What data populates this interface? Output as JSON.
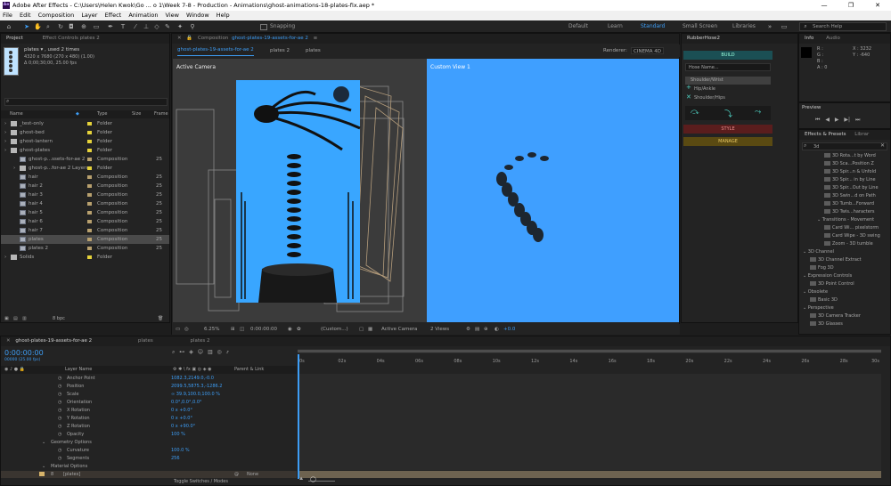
{
  "titlebar": {
    "title": "Adobe After Effects - C:\\Users\\Helen Kwok\\Go ... o 1\\Week 7-8 - Production - Animations\\ghost-animations-18-plates-fix.aep *",
    "logo": "Ae",
    "minimize": "—",
    "maximize": "❐",
    "close": "✕"
  },
  "menu": [
    "File",
    "Edit",
    "Composition",
    "Layer",
    "Effect",
    "Animation",
    "View",
    "Window",
    "Help"
  ],
  "toolbar": {
    "snapping_label": "Snapping",
    "workspaces": [
      "Default",
      "Learn",
      "Standard",
      "Small Screen",
      "Libraries"
    ],
    "active_workspace": "Standard",
    "search_placeholder": "Search Help"
  },
  "project": {
    "tabs": [
      "Project",
      "Effect Controls plates 2"
    ],
    "selected_name": "plates ▾ , used 2 times",
    "selected_dims": "4320 x 7680 (270 x 480) (1.00)",
    "selected_duration": "Δ 0;00;30;00, 25.00 fps",
    "search_placeholder": "",
    "columns": [
      "Name",
      "Type",
      "Size",
      "Frame"
    ],
    "rows": [
      {
        "name": "_test-only",
        "type": "Folder",
        "size": "",
        "indent": 0,
        "kind": "folder"
      },
      {
        "name": "ghost-bed",
        "type": "Folder",
        "size": "",
        "indent": 0,
        "kind": "folder"
      },
      {
        "name": "ghost-lantern",
        "type": "Folder",
        "size": "",
        "indent": 0,
        "kind": "folder"
      },
      {
        "name": "ghost-plates",
        "type": "Folder",
        "size": "",
        "indent": 0,
        "kind": "folder"
      },
      {
        "name": "ghost-p...ssets-for-ae 2",
        "type": "Composition",
        "size": "25",
        "indent": 1,
        "kind": "comp"
      },
      {
        "name": "ghost-p...for-ae 2 Layers",
        "type": "Folder",
        "size": "",
        "indent": 1,
        "kind": "folder"
      },
      {
        "name": "hair",
        "type": "Composition",
        "size": "25",
        "indent": 1,
        "kind": "comp"
      },
      {
        "name": "hair 2",
        "type": "Composition",
        "size": "25",
        "indent": 1,
        "kind": "comp"
      },
      {
        "name": "hair 3",
        "type": "Composition",
        "size": "25",
        "indent": 1,
        "kind": "comp"
      },
      {
        "name": "hair 4",
        "type": "Composition",
        "size": "25",
        "indent": 1,
        "kind": "comp"
      },
      {
        "name": "hair 5",
        "type": "Composition",
        "size": "25",
        "indent": 1,
        "kind": "comp"
      },
      {
        "name": "hair 6",
        "type": "Composition",
        "size": "25",
        "indent": 1,
        "kind": "comp"
      },
      {
        "name": "hair 7",
        "type": "Composition",
        "size": "25",
        "indent": 1,
        "kind": "comp"
      },
      {
        "name": "plates",
        "type": "Composition",
        "size": "25",
        "indent": 1,
        "kind": "comp",
        "selected": true
      },
      {
        "name": "plates 2",
        "type": "Composition",
        "size": "25",
        "indent": 1,
        "kind": "comp"
      },
      {
        "name": "Solids",
        "type": "Folder",
        "size": "",
        "indent": 0,
        "kind": "folder"
      }
    ],
    "footer_bpc": "8 bpc"
  },
  "viewer": {
    "tab_prefix": "Composition",
    "tab_name": "ghost-plates-19-assets-for-ae 2",
    "subtabs": [
      "ghost-plates-19-assets-for-ae 2",
      "plates 2",
      "plates"
    ],
    "renderer_label": "Renderer:",
    "renderer": "CINEMA 4D",
    "left_label": "Active Camera",
    "right_label": "Custom View 1",
    "zoom": "6.25%",
    "timecode": "0:00:00:00",
    "resolution": "(Custom...)",
    "camera": "Active Camera",
    "views": "2 Views",
    "exposure": "+0.0"
  },
  "rubberhose": {
    "title": "RubberHose2",
    "build": "BUILD",
    "hose_name_placeholder": "Hose Name...",
    "items": [
      "Shoulder/Wrist",
      "Hip/Ankle",
      "Shoulder/Hips"
    ],
    "style": "STYLE",
    "manage": "MANAGE"
  },
  "info": {
    "tabs": [
      "Info",
      "Audio"
    ],
    "r": "R :",
    "g": "G :",
    "b": "B :",
    "a": "A : 0",
    "x": "X : 3232",
    "y": "Y : -640"
  },
  "preview": {
    "title": "Preview"
  },
  "effects": {
    "tabs": [
      "Effects & Presets",
      "Librar"
    ],
    "search": "3d",
    "items": [
      {
        "label": "3D Rota...t by Word",
        "indent": 3
      },
      {
        "label": "3D Sca...Position Z",
        "indent": 3
      },
      {
        "label": "3D Spir...n & Unfold",
        "indent": 3
      },
      {
        "label": "3D Spir... in by Line",
        "indent": 3
      },
      {
        "label": "3D Spir...Out by Line",
        "indent": 3
      },
      {
        "label": "3D Swin...d on Path",
        "indent": 3
      },
      {
        "label": "3D Tumb...Forward",
        "indent": 3
      },
      {
        "label": "3D Twis...haracters",
        "indent": 3
      },
      {
        "label": "Transitions - Movement",
        "indent": 2,
        "folder": true
      },
      {
        "label": "Card Wi... pixelstorm",
        "indent": 3
      },
      {
        "label": "Card Wipe - 3D swing",
        "indent": 3
      },
      {
        "label": "Zoom - 3D tumble",
        "indent": 3
      },
      {
        "label": "3D Channel",
        "indent": 0,
        "folder": true
      },
      {
        "label": "3D Channel Extract",
        "indent": 1
      },
      {
        "label": "Fog 3D",
        "indent": 1
      },
      {
        "label": "Expression Controls",
        "indent": 0,
        "folder": true
      },
      {
        "label": "3D Point Control",
        "indent": 1
      },
      {
        "label": "Obsolete",
        "indent": 0,
        "folder": true
      },
      {
        "label": "Basic 3D",
        "indent": 1
      },
      {
        "label": "Perspective",
        "indent": 0,
        "folder": true
      },
      {
        "label": "3D Camera Tracker",
        "indent": 1
      },
      {
        "label": "3D Glasses",
        "indent": 1
      }
    ]
  },
  "timeline": {
    "tabs": [
      "ghost-plates-19-assets-for-ae 2",
      "plates",
      "plates 2"
    ],
    "timecode": "0:00:00:00",
    "frame_info": "00000 (25.00 fps)",
    "col_layer_name": "Layer Name",
    "col_parent": "Parent & Link",
    "properties": [
      {
        "label": "Anchor Point",
        "value": "1082.3,2149.0,-0.0",
        "indent": 1
      },
      {
        "label": "Position",
        "value": "2099.5,5875.3,-1286.2",
        "indent": 1
      },
      {
        "label": "Scale",
        "value": "∞ 39.9,100.0,100.0 %",
        "indent": 1
      },
      {
        "label": "Orientation",
        "value": "0.0°,0.0°,0.0°",
        "indent": 1
      },
      {
        "label": "X Rotation",
        "value": "0 x +0.0°",
        "indent": 1
      },
      {
        "label": "Y Rotation",
        "value": "0 x +0.0°",
        "indent": 1
      },
      {
        "label": "Z Rotation",
        "value": "0 x +90.0°",
        "indent": 1
      },
      {
        "label": "Opacity",
        "value": "100 %",
        "indent": 1
      },
      {
        "label": "Geometry Options",
        "value": "",
        "indent": 0,
        "group": true
      },
      {
        "label": "Curvature",
        "value": "100.0 %",
        "indent": 1
      },
      {
        "label": "Segments",
        "value": "256",
        "indent": 1
      },
      {
        "label": "Material Options",
        "value": "",
        "indent": 0,
        "group": true
      }
    ],
    "layer_row": {
      "num": "8",
      "name": "[plates]",
      "parent": "None"
    },
    "ruler": [
      "0s",
      "02s",
      "04s",
      "06s",
      "08s",
      "10s",
      "12s",
      "14s",
      "16s",
      "18s",
      "20s",
      "22s",
      "24s",
      "26s",
      "28s",
      "30s"
    ],
    "footer": "Toggle Switches / Modes"
  }
}
